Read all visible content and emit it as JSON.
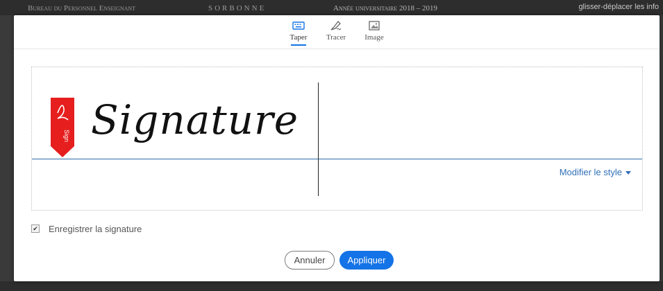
{
  "background": {
    "left_text": "Bureau du Personnel Enseignant",
    "center_text": "SORBONNE",
    "right_text": "Année universitaire 2018 – 2019",
    "hint_text": "glisser-déplacer les info"
  },
  "tabs": [
    {
      "label": "Taper",
      "icon": "keyboard-icon",
      "active": true
    },
    {
      "label": "Tracer",
      "icon": "pen-draw-icon",
      "active": false
    },
    {
      "label": "Image",
      "icon": "image-icon",
      "active": false
    }
  ],
  "signature": {
    "text": "Signature",
    "tag_label": "Sign",
    "modify_style_label": "Modifier le style"
  },
  "save_signature": {
    "label": "Enregistrer la signature",
    "checked": true
  },
  "buttons": {
    "cancel_label": "Annuler",
    "apply_label": "Appliquer"
  },
  "colors": {
    "accent": "#1473e6",
    "link": "#2f6fb7",
    "sign_tag": "#e61e1e",
    "baseline": "#2c6aa8"
  }
}
